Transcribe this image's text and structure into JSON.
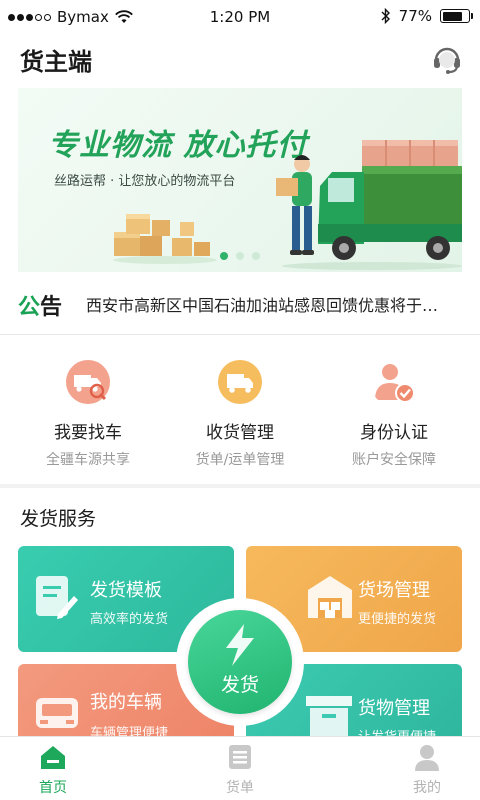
{
  "status_bar": {
    "carrier": "Bymax",
    "time": "1:20 PM",
    "battery_text": "77%",
    "battery_level": 0.77
  },
  "header": {
    "title": "货主端",
    "icon": "headset-icon"
  },
  "banner": {
    "title": "专业物流 放心托付",
    "subtitle": "丝路运帮 · 让您放心的物流平台",
    "slide_count": 3,
    "active_slide": 1,
    "accent_color": "#23a35a"
  },
  "notice": {
    "tag": "公告",
    "text": "西安市高新区中国石油加油站感恩回馈优惠将于…"
  },
  "quick_actions": [
    {
      "title": "我要找车",
      "subtitle": "全疆车源共享",
      "icon": "find-truck-icon",
      "color": "#f08a6e"
    },
    {
      "title": "收货管理",
      "subtitle": "货单/运单管理",
      "icon": "truck-icon",
      "color": "#f3b555"
    },
    {
      "title": "身份认证",
      "subtitle": "账户安全保障",
      "icon": "user-verify-icon",
      "color": "#f08a6e"
    }
  ],
  "shipping_service": {
    "section_title": "发货服务",
    "cards": [
      {
        "title": "发货模板",
        "subtitle": "高效率的发货",
        "icon": "template-icon"
      },
      {
        "title": "货场管理",
        "subtitle": "更便捷的发货",
        "icon": "warehouse-icon"
      },
      {
        "title": "我的车辆",
        "subtitle": "车辆管理便捷",
        "icon": "vehicle-icon"
      },
      {
        "title": "货物管理",
        "subtitle": "让发货更便捷",
        "icon": "cargo-box-icon"
      }
    ],
    "fab_label": "发货",
    "fab_icon": "lightning-icon"
  },
  "tabbar": {
    "tabs": [
      {
        "label": "首页",
        "icon": "home-icon",
        "active": true
      },
      {
        "label": "货单",
        "icon": "order-list-icon",
        "active": false
      },
      {
        "label": "我的",
        "icon": "profile-icon",
        "active": false
      }
    ],
    "active_color": "#1ea85b"
  }
}
